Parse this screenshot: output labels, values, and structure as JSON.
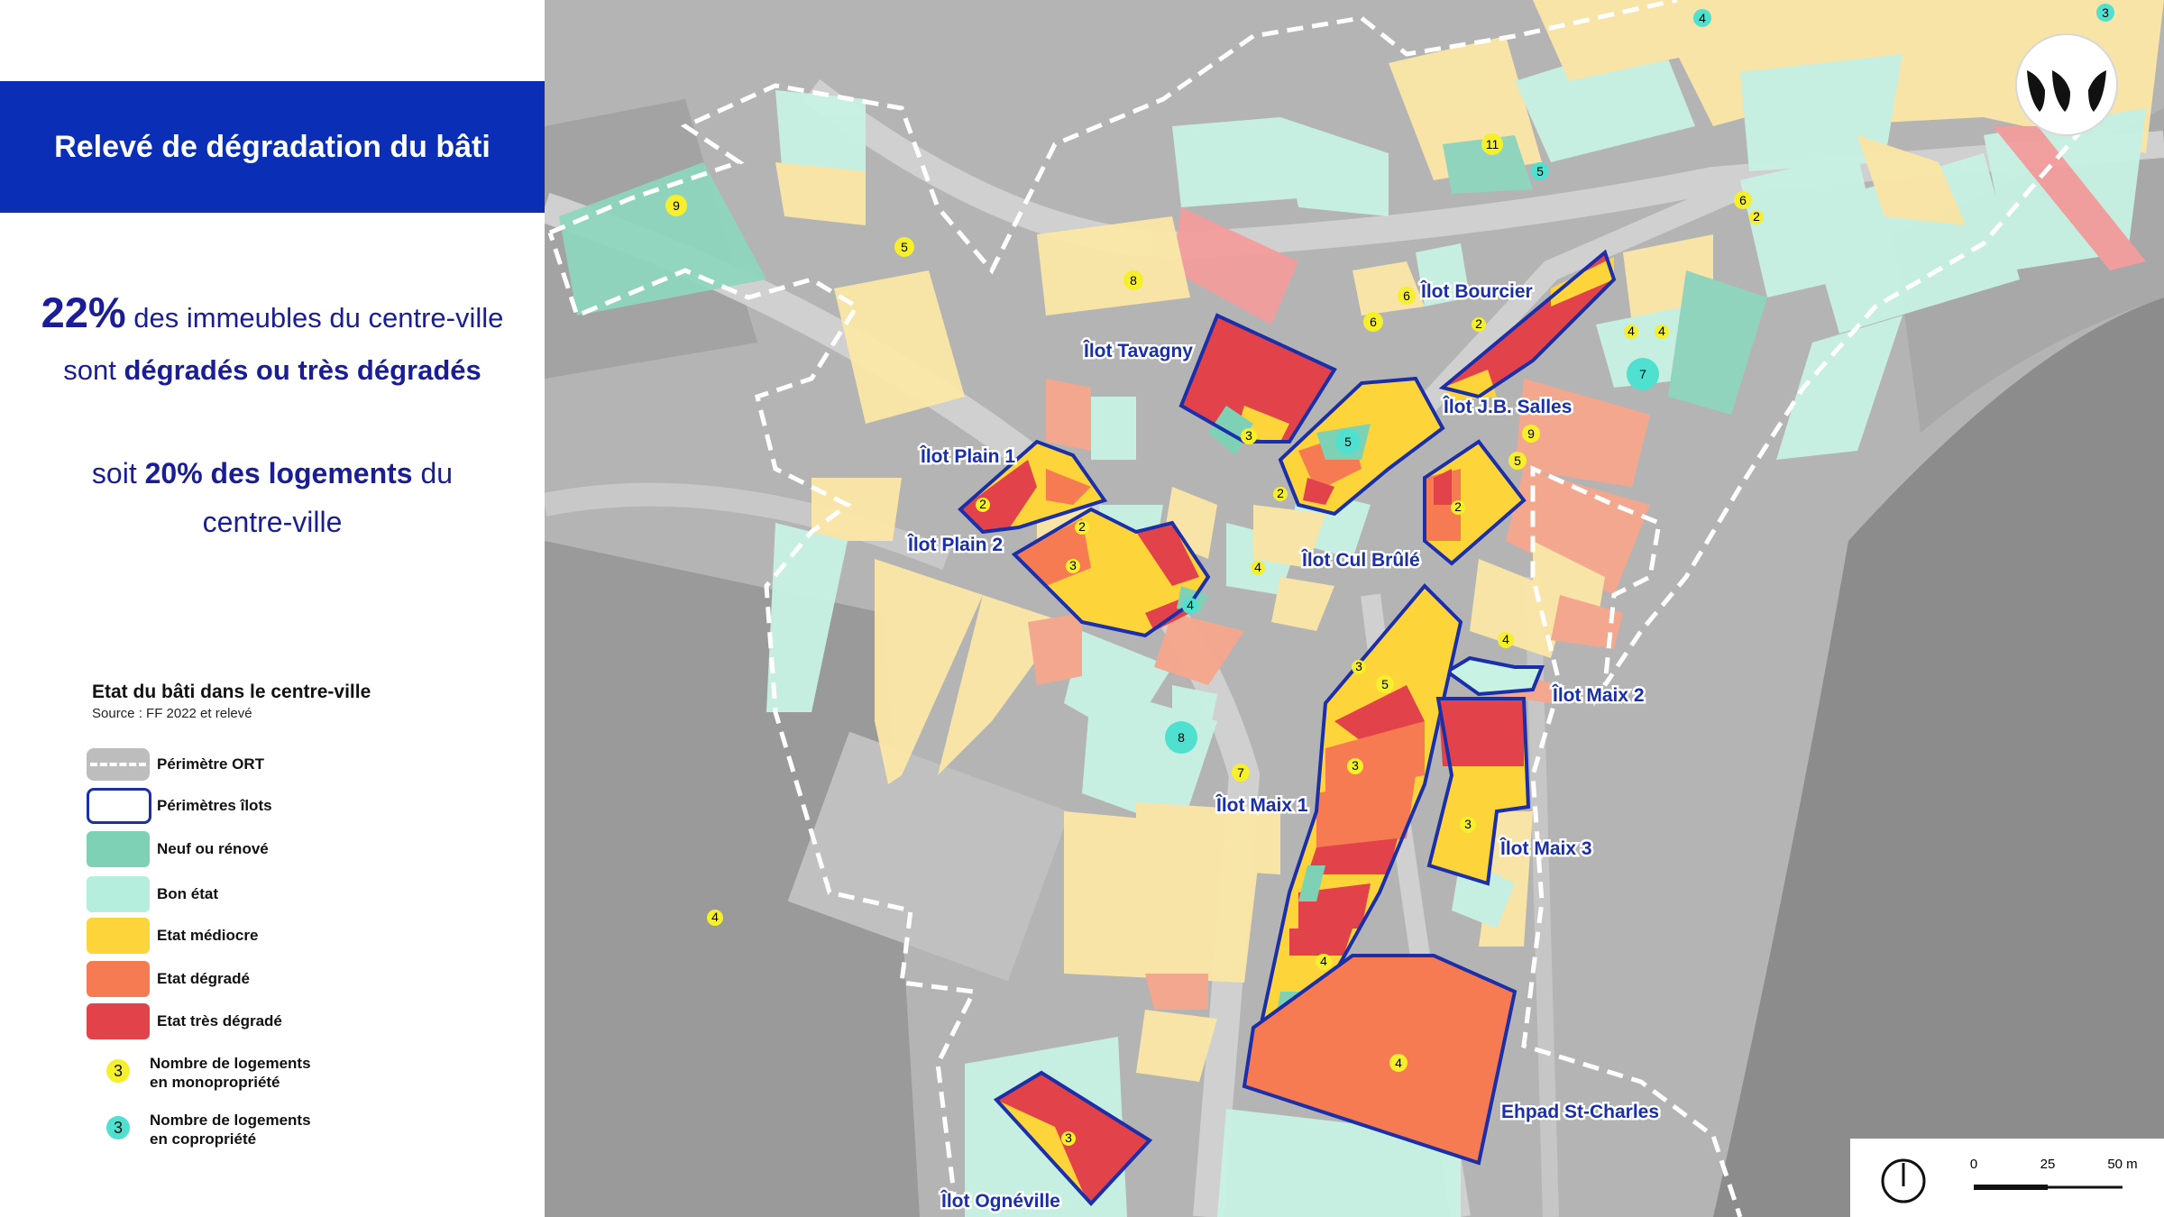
{
  "title": "Relevé de dégradation du bâti",
  "stat": {
    "pct1": "22%",
    "line1_rest": " des immeubles du centre-ville",
    "line2_pre": "sont ",
    "line2_bold": "dégradés ou très dégradés",
    "line3_pre": "soit ",
    "line3_bold": "20% des logements",
    "line3_post": " du",
    "line4": "centre-ville"
  },
  "legend": {
    "title": "Etat du bâti dans le centre-ville",
    "source": "Source : FF 2022 et relevé",
    "items": [
      {
        "label": "Périmètre ORT"
      },
      {
        "label": "Périmètres îlots"
      },
      {
        "label": "Neuf ou rénové",
        "color": "#7fd1b5"
      },
      {
        "label": "Bon état",
        "color": "#b5eedd"
      },
      {
        "label": "Etat médiocre",
        "color": "#fdd43a"
      },
      {
        "label": "Etat dégradé",
        "color": "#f77b52"
      },
      {
        "label": "Etat très dégradé",
        "color": "#e2434a"
      }
    ],
    "mono": {
      "number": "3",
      "line1": "Nombre de logements",
      "line2": "en monopropriété",
      "color": "#f6ef2b"
    },
    "copro": {
      "number": "3",
      "line1": "Nombre de logements",
      "line2": "en copropriété",
      "color": "#4fe0cf"
    }
  },
  "map": {
    "ilots": [
      "Îlot Bourcier",
      "Îlot Tavagny",
      "Îlot J.B. Salles",
      "Îlot Plain 1",
      "Îlot Plain 2",
      "Îlot Cul Brûlé",
      "Îlot Maix 2",
      "Îlot Maix 1",
      "Îlot Maix 3",
      "Ehpad St-Charles",
      "Îlot Ognéville"
    ],
    "scale": {
      "labels": [
        "0",
        "25",
        "50 m"
      ]
    },
    "north_arrow": "north-arrow-icon",
    "logo": "brand-logo-icon"
  },
  "colors": {
    "brand_blue": "#0a2fb6",
    "ilot_border": "#1a2fa8",
    "new": "#7fd1b5",
    "good": "#b5eedd",
    "mediocre": "#fdd43a",
    "degraded": "#f77b52",
    "very_degraded": "#e2434a"
  }
}
